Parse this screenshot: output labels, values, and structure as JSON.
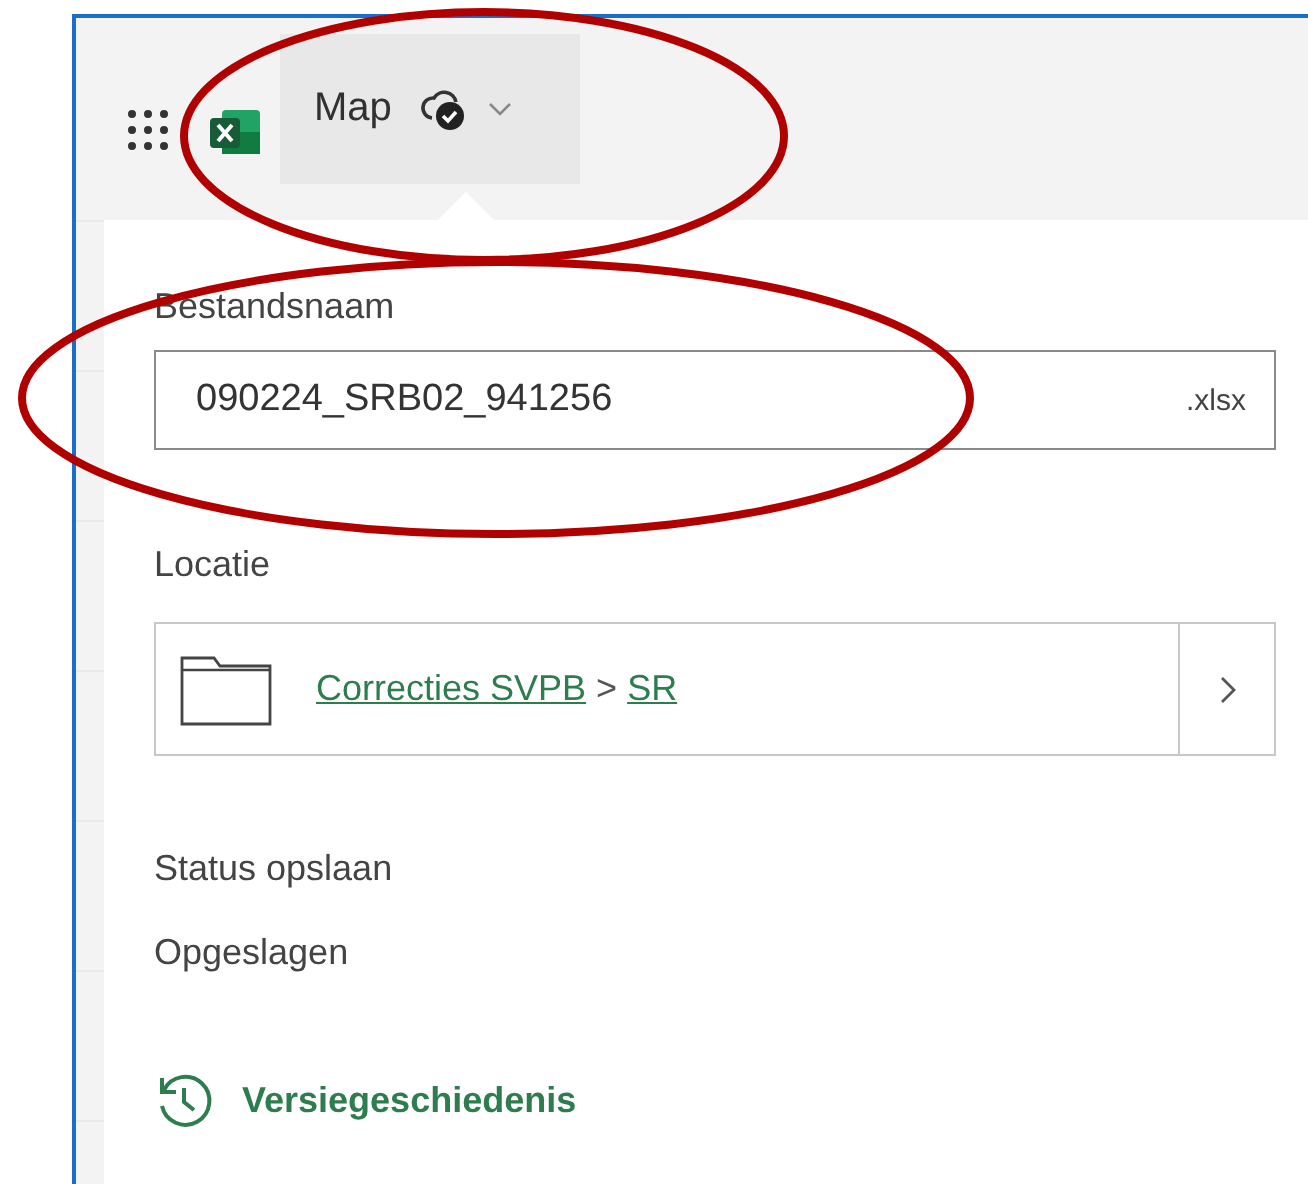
{
  "app_bar": {
    "file_title": "Map"
  },
  "file_panel": {
    "filename_label": "Bestandsnaam",
    "filename": "090224_SRB02_941256",
    "extension": ".xlsx",
    "location_label": "Locatie",
    "location_path": [
      {
        "label": "Correcties SVPB"
      },
      {
        "label": "SR"
      }
    ],
    "path_separator": ">",
    "save_status_label": "Status opslaan",
    "save_status": "Opgeslagen",
    "version_history": "Versiegeschiedenis"
  }
}
